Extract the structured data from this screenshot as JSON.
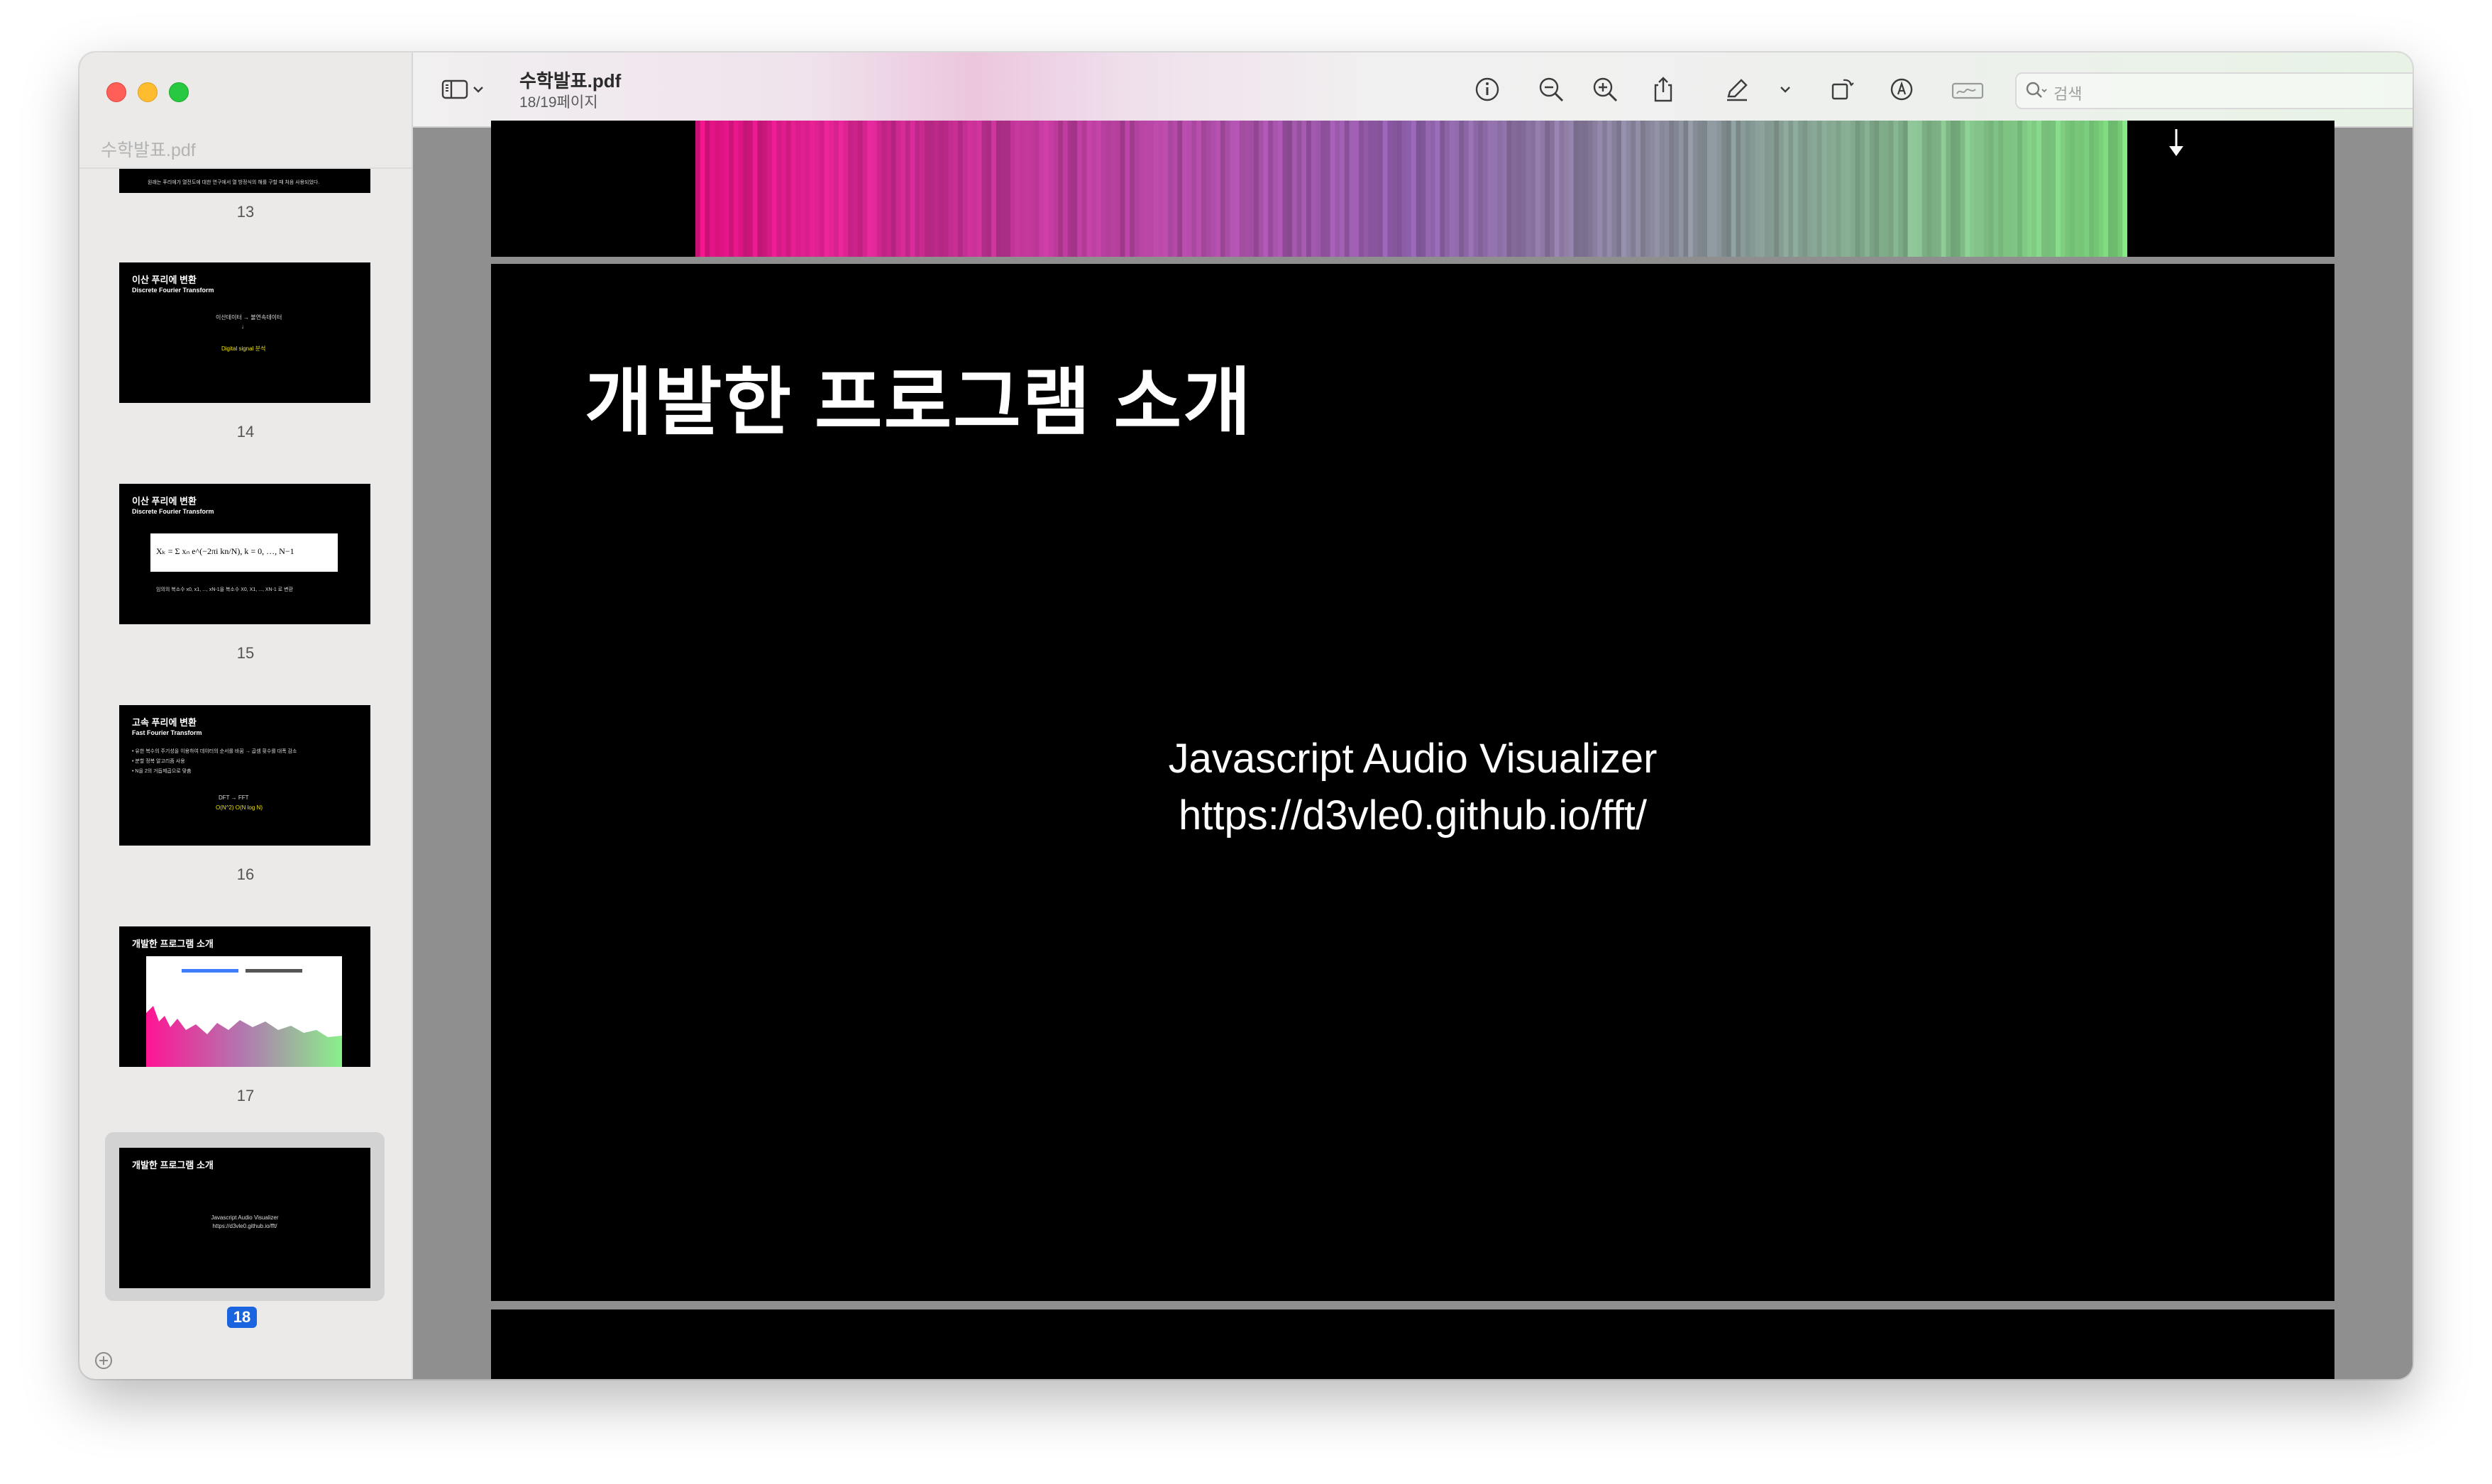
{
  "app": {
    "sidebar_filename": "수학발표.pdf",
    "doc_title": "수학발표.pdf",
    "page_indicator": "18/19페이지",
    "search_placeholder": "검색"
  },
  "sidebar": {
    "thumbnails": [
      {
        "page": "13",
        "line": "원래는 푸리에가 열전도에 대한 연구에서 열 방정식의 해를 구할 때 처음 사용되었다."
      },
      {
        "page": "14",
        "title": "이산 푸리에 변환",
        "subtitle": "Discrete Fourier Transform",
        "lines": [
          "이산데이터 → 불연속데이터",
          "↓",
          "Digital signal 분석"
        ]
      },
      {
        "page": "15",
        "title": "이산 푸리에 변환",
        "subtitle": "Discrete Fourier Transform",
        "formula": "Xₖ = Σ xₙ e^(−2πi kn/N), k = 0, …, N−1",
        "line": "임의의 복소수 x0, x1, ..., xN-1을 복소수 X0, X1, ..., XN-1 로 변환"
      },
      {
        "page": "16",
        "title": "고속 푸리에 변환",
        "subtitle": "Fast Fourier Transform",
        "lines": [
          "• 유한 복수의 주기성을 이용하여 데이터의 순서를 바꿈 → 곱셈 횟수를 대폭 감소",
          "• 분할 정복 알고리즘 사용",
          "• N을 2의 거듭제곱으로 맞춤",
          "DFT → FFT",
          "O(N^2)   O(N log N)"
        ]
      },
      {
        "page": "17",
        "title": "개발한 프로그램 소개"
      },
      {
        "page": "18",
        "title": "개발한 프로그램 소개",
        "lines": [
          "Javascript Audio Visualizer",
          "https://d3vle0.github.io/fft/"
        ],
        "selected": true
      }
    ]
  },
  "slide": {
    "title": "개발한 프로그램 소개",
    "line1": "Javascript Audio Visualizer",
    "line2": "https://d3vle0.github.io/fft/"
  },
  "colors": {
    "selection_badge": "#1b64e0",
    "spectrum_start": "#ff1493",
    "spectrum_mid": "#a06bc0",
    "spectrum_end": "#8af08a"
  },
  "icons": [
    "sidebar-toggle-icon",
    "chevron-down-icon",
    "info-icon",
    "zoom-out-icon",
    "zoom-in-icon",
    "share-icon",
    "markup-pen-icon",
    "rotate-icon",
    "markup-circle-icon",
    "signature-icon",
    "search-icon"
  ]
}
